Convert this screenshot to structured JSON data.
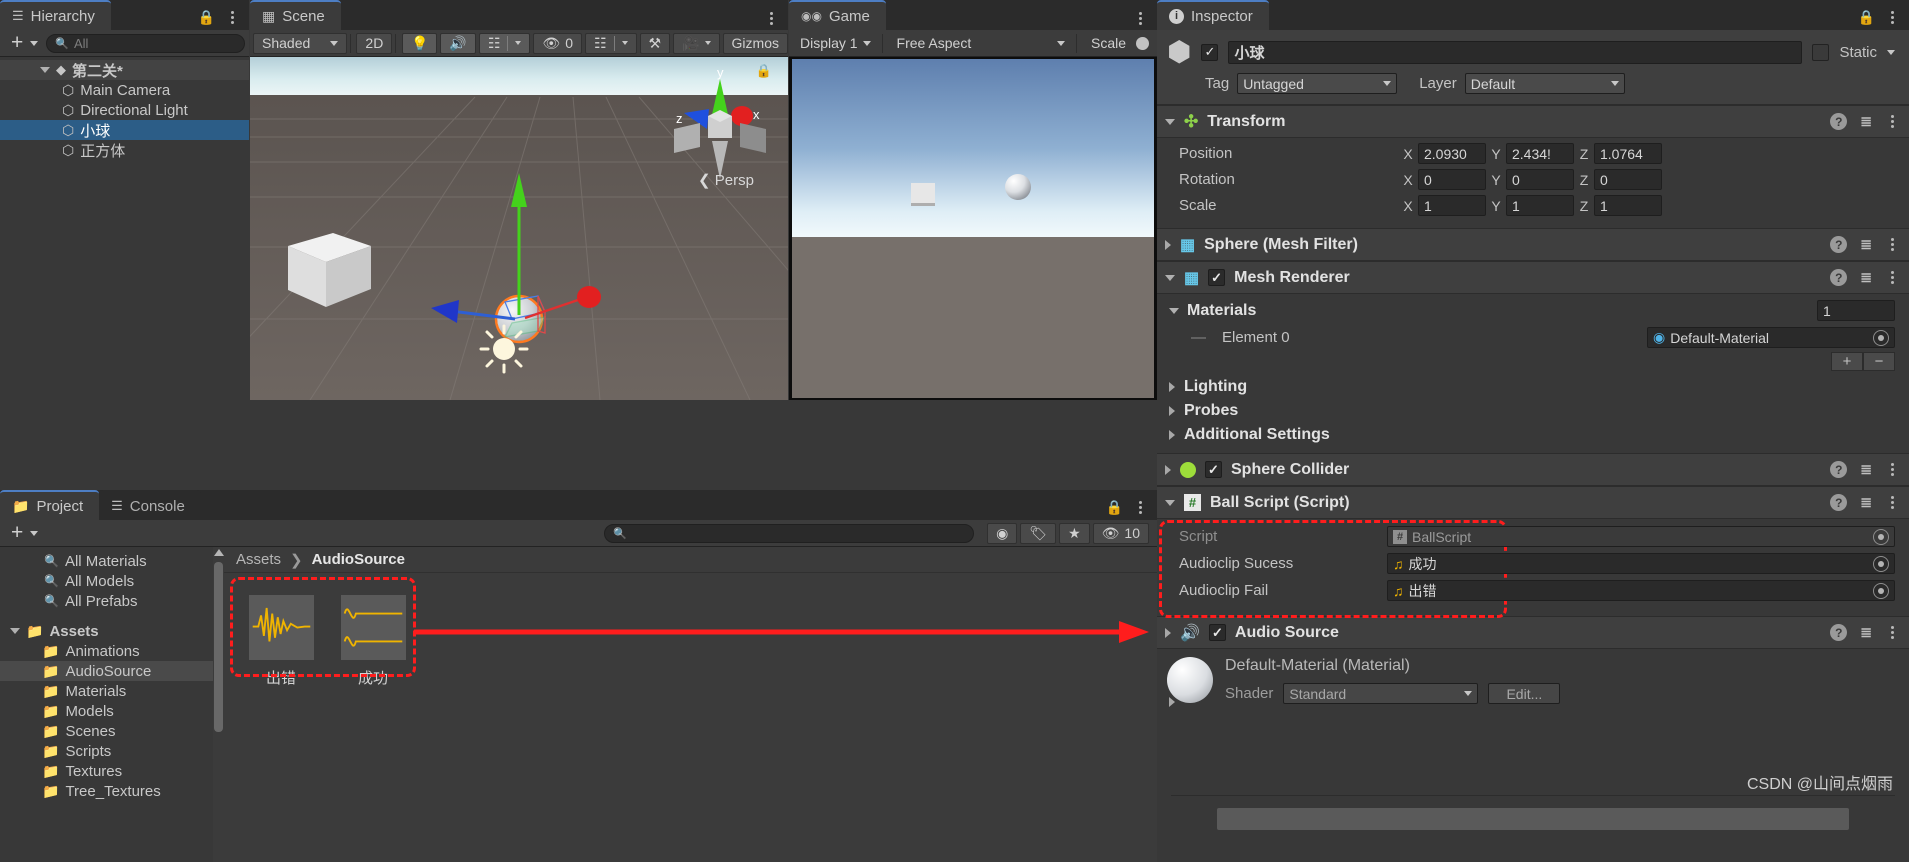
{
  "hierarchy": {
    "tab_label": "Hierarchy",
    "search_placeholder": "All",
    "scene_name": "第二关*",
    "items": [
      {
        "label": "Main Camera",
        "selected": false
      },
      {
        "label": "Directional Light",
        "selected": false
      },
      {
        "label": "小球",
        "selected": true
      },
      {
        "label": "正方体",
        "selected": false
      }
    ]
  },
  "scene": {
    "tab_label": "Scene",
    "shading_mode": "Shaded",
    "mode_2d": "2D",
    "hidden_count": "0",
    "gizmos_label": "Gizmos",
    "axis_labels": {
      "x": "x",
      "y": "y",
      "z": "z"
    },
    "projection": "Persp"
  },
  "game": {
    "tab_label": "Game",
    "display": "Display 1",
    "aspect": "Free Aspect",
    "scale_label": "Scale"
  },
  "project": {
    "tab_label": "Project",
    "console_tab_label": "Console",
    "search_placeholder": "",
    "hidden_count": "10",
    "breadcrumb": [
      "Assets",
      "AudioSource"
    ],
    "filters": [
      {
        "label": "All Materials"
      },
      {
        "label": "All Models"
      },
      {
        "label": "All Prefabs"
      }
    ],
    "tree": [
      {
        "label": "Assets",
        "depth": 0,
        "root": true,
        "selected": false
      },
      {
        "label": "Animations",
        "depth": 1,
        "root": false,
        "selected": false
      },
      {
        "label": "AudioSource",
        "depth": 1,
        "root": false,
        "selected": true
      },
      {
        "label": "Materials",
        "depth": 1,
        "root": false,
        "selected": false
      },
      {
        "label": "Models",
        "depth": 1,
        "root": false,
        "selected": false
      },
      {
        "label": "Scenes",
        "depth": 1,
        "root": false,
        "selected": false
      },
      {
        "label": "Scripts",
        "depth": 1,
        "root": false,
        "selected": false
      },
      {
        "label": "Textures",
        "depth": 1,
        "root": false,
        "selected": false
      },
      {
        "label": "Tree_Textures",
        "depth": 1,
        "root": false,
        "selected": false
      }
    ],
    "assets": [
      {
        "label": "出错",
        "kind": "audioclip"
      },
      {
        "label": "成功",
        "kind": "audioclip"
      }
    ]
  },
  "inspector": {
    "tab_label": "Inspector",
    "object_name": "小球",
    "enabled": true,
    "static_label": "Static",
    "tag_label": "Tag",
    "tag_value": "Untagged",
    "layer_label": "Layer",
    "layer_value": "Default",
    "transform": {
      "title": "Transform",
      "rows": [
        {
          "label": "Position",
          "x": "2.0930",
          "y": "2.434!",
          "z": "1.0764"
        },
        {
          "label": "Rotation",
          "x": "0",
          "y": "0",
          "z": "0"
        },
        {
          "label": "Scale",
          "x": "1",
          "y": "1",
          "z": "1"
        }
      ]
    },
    "mesh_filter": {
      "title": "Sphere (Mesh Filter)"
    },
    "mesh_renderer": {
      "title": "Mesh Renderer",
      "materials_label": "Materials",
      "materials_count": "1",
      "element_label": "Element 0",
      "element_value": "Default-Material",
      "add_label": "+",
      "remove_label": "−",
      "foldouts": [
        "Lighting",
        "Probes",
        "Additional Settings"
      ]
    },
    "sphere_collider": {
      "title": "Sphere Collider"
    },
    "ball_script": {
      "title": "Ball Script (Script)",
      "rows": [
        {
          "label": "Script",
          "value": "BallScript",
          "icon": "cs-script-icon",
          "disabled": true
        },
        {
          "label": "Audioclip Sucess",
          "value": "成功",
          "icon": "audio-note-icon",
          "disabled": false
        },
        {
          "label": "Audioclip Fail",
          "value": "出错",
          "icon": "audio-note-icon",
          "disabled": false
        }
      ]
    },
    "audio_source": {
      "title": "Audio Source"
    },
    "material_preview": {
      "title": "Default-Material (Material)",
      "shader_label": "Shader",
      "shader_value": "Standard",
      "edit_label": "Edit..."
    }
  },
  "watermark": "CSDN @山间点烟雨",
  "colors": {
    "accent_blue": "#4d7ec4",
    "selection_blue": "#2c5d87",
    "annotation_red": "#ff1d1d",
    "panel_bg": "#383838",
    "panel_dark": "#2b2b2b",
    "audio_wave": "#f0b400"
  }
}
